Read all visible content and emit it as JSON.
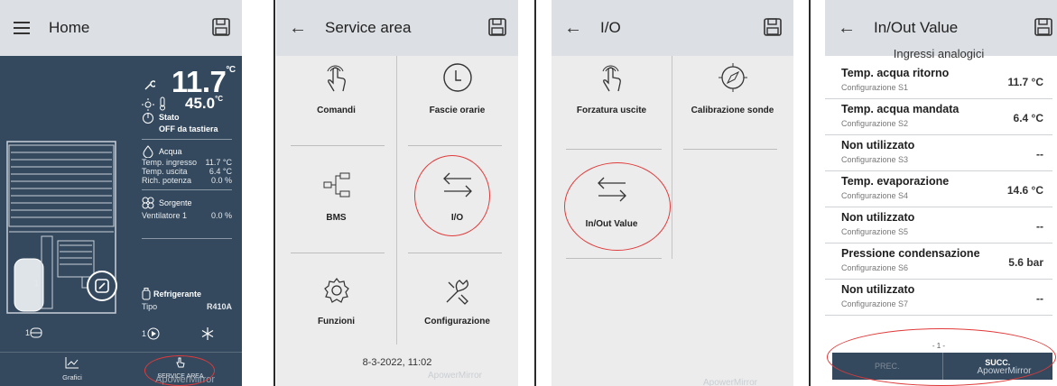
{
  "home": {
    "title": "Home",
    "temp_main": "11.7",
    "temp_main_unit": "°C",
    "temp_ext": "45.0",
    "temp_ext_unit": "°C",
    "stato_label": "Stato",
    "stato_value": "OFF da tastiera",
    "acqua_label": "Acqua",
    "acqua_rows": [
      {
        "label": "Temp. ingresso",
        "value": "11.7 °C"
      },
      {
        "label": "Temp. uscita",
        "value": "6.4 °C"
      },
      {
        "label": "Rich. potenza",
        "value": "0.0 %"
      }
    ],
    "sorgente_label": "Sorgente",
    "ventilatore_label": "Ventilatore 1",
    "ventilatore_value": "0.0 %",
    "refrigerante_label": "Refrigerante",
    "tipo_label": "Tipo",
    "tipo_value": "R410A",
    "compressor_index": "1",
    "pump_index": "1",
    "nav_grafici": "Grafici",
    "nav_service": "SERVICE AREA",
    "watermark": "ApowerMirror"
  },
  "service": {
    "title": "Service area",
    "tiles": [
      "Comandi",
      "Fascie orarie",
      "BMS",
      "I/O",
      "Funzioni",
      "Configurazione"
    ],
    "datetime": "8-3-2022, 11:02",
    "watermark": "ApowerMirror"
  },
  "io": {
    "title": "I/O",
    "tiles": [
      "Forzatura uscite",
      "Calibrazione sonde",
      "In/Out Value"
    ],
    "watermark": "ApowerMirror"
  },
  "inout": {
    "title": "In/Out Value",
    "section": "Ingressi analogici",
    "rows": [
      {
        "name": "Temp. acqua ritorno",
        "config": "Configurazione S1",
        "value": "11.7 °C"
      },
      {
        "name": "Temp. acqua mandata",
        "config": "Configurazione S2",
        "value": "6.4 °C"
      },
      {
        "name": "Non utilizzato",
        "config": "Configurazione S3",
        "value": "--"
      },
      {
        "name": "Temp. evaporazione",
        "config": "Configurazione S4",
        "value": "14.6 °C"
      },
      {
        "name": "Non utilizzato",
        "config": "Configurazione S5",
        "value": "--"
      },
      {
        "name": "Pressione condensazione",
        "config": "Configurazione S6",
        "value": "5.6 bar"
      },
      {
        "name": "Non utilizzato",
        "config": "Configurazione S7",
        "value": "--"
      }
    ],
    "page_indicator": "- 1 -",
    "prev_label": "PREC.",
    "next_label": "SUCC.",
    "watermark": "ApowerMirror"
  },
  "colors": {
    "appbar": "#dcdfe3",
    "home_bg": "#34495e",
    "annotation": "#e13a3a"
  }
}
